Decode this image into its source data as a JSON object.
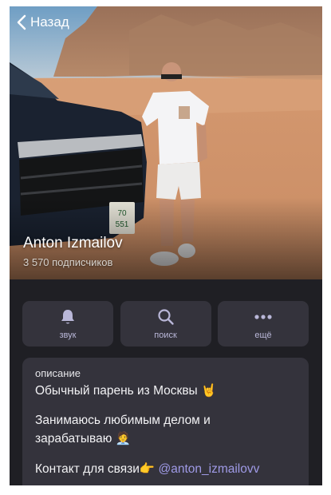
{
  "nav": {
    "back_label": "Назад"
  },
  "profile": {
    "name": "Anton Izmailov",
    "subscribers": "3 570 подписчиков"
  },
  "actions": [
    {
      "label": "звук",
      "icon": "bell-icon"
    },
    {
      "label": "поиск",
      "icon": "search-icon"
    },
    {
      "label": "ещё",
      "icon": "more-dots-icon"
    }
  ],
  "about": {
    "heading": "описание",
    "line1": "Обычный парень из Москвы 🤘",
    "line2": "Занимаюсь любимым делом и",
    "line3": "зарабатываю 🧑‍💼",
    "line4": "Контакт для связи👉",
    "contact_link": "@anton_izmailovv"
  },
  "plate_text": "70\n551"
}
